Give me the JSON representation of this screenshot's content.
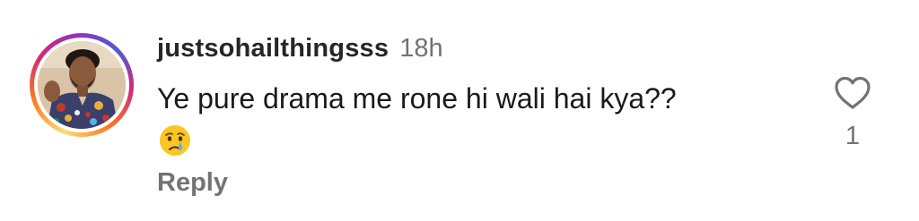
{
  "comment": {
    "username": "justsohailthingsss",
    "timestamp": "18h",
    "text": "Ye pure drama me rone hi wali hai kya??",
    "emoji": "crying-face",
    "reply_label": "Reply",
    "like_count": "1",
    "like_icon": "heart-outline-icon",
    "avatar_story_ring": true
  },
  "colors": {
    "username": "#262626",
    "secondary_text": "#737373",
    "ring_start": "#feda75",
    "ring_mid": "#d62976",
    "ring_end": "#962fbf"
  }
}
